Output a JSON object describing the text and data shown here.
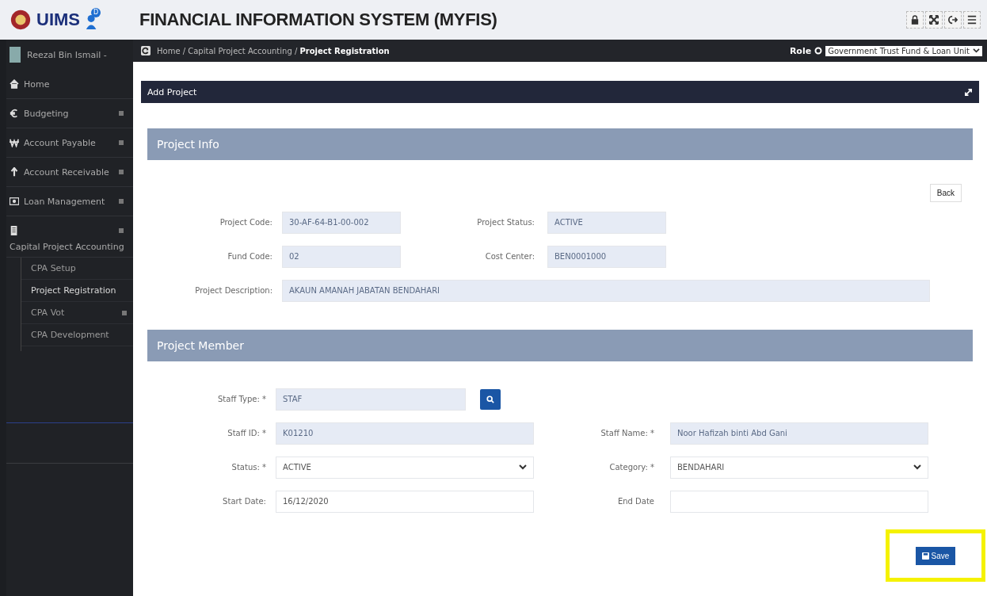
{
  "header": {
    "title": "FINANCIAL INFORMATION SYSTEM (MYFIS)",
    "logo_text": "UIMS",
    "badge": "D"
  },
  "sidebar": {
    "user": "Reezal Bin Ismail -",
    "items": [
      {
        "label": "Home",
        "kind": "home",
        "expandable": false,
        "expanded": false
      },
      {
        "label": "Budgeting",
        "kind": "euro",
        "expandable": true,
        "expanded": false
      },
      {
        "label": "Account Payable",
        "kind": "won",
        "expandable": true,
        "expanded": false
      },
      {
        "label": "Account Receivable",
        "kind": "arrow",
        "expandable": true,
        "expanded": false
      },
      {
        "label": "Loan Management",
        "kind": "money",
        "expandable": true,
        "expanded": false
      },
      {
        "label": "Capital Project Accounting",
        "kind": "building",
        "expandable": true,
        "expanded": true,
        "children": [
          {
            "label": "CPA Setup",
            "selected": false,
            "expandable": false
          },
          {
            "label": "Project Registration",
            "selected": true,
            "expandable": false
          },
          {
            "label": "CPA Vot",
            "selected": false,
            "expandable": true
          },
          {
            "label": "CPA Development",
            "selected": false,
            "expandable": false
          }
        ]
      }
    ]
  },
  "breadcrumb": "Home / Capital Project Accounting / **Project Registration**",
  "role": {
    "label": "Role",
    "value": "Government Trust Fund & Loan Unit"
  },
  "panel": {
    "title": "Add Project"
  },
  "project_info": {
    "title": "Project Info",
    "back_button": "Back",
    "rows": [
      [
        {
          "label": "Project Code:",
          "value": "30-AF-64-B1-00-002",
          "kind": "input",
          "readonly": true
        },
        {
          "label": "Project Status:",
          "value": "ACTIVE",
          "kind": "input",
          "readonly": true
        }
      ],
      [
        {
          "label": "Fund Code:",
          "value": "02",
          "kind": "input",
          "readonly": true
        },
        {
          "label": "Cost Center:",
          "value": "BEN0001000",
          "kind": "input",
          "readonly": true
        }
      ],
      [
        {
          "label": "Project Description:",
          "value": "AKAUN AMANAH JABATAN BENDAHARI",
          "kind": "input",
          "readonly": true,
          "wide": true
        }
      ]
    ]
  },
  "project_member": {
    "title": "Project Member",
    "save_button": "Save",
    "rows": [
      [
        {
          "label": "Staff Type: *",
          "value": "STAF",
          "kind": "lookup",
          "readonly": true
        }
      ],
      [
        {
          "label": "Staff ID: *",
          "value": "K01210",
          "kind": "input",
          "readonly": true
        },
        {
          "label": "Staff Name: *",
          "value": "Noor Hafizah binti Abd Gani",
          "kind": "input",
          "readonly": true
        }
      ],
      [
        {
          "label": "Status: *",
          "value": "ACTIVE",
          "kind": "select",
          "readonly": false
        },
        {
          "label": "Category: *",
          "value": "BENDAHARI",
          "kind": "select",
          "readonly": false
        }
      ],
      [
        {
          "label": "Start Date:",
          "value": "16/12/2020",
          "kind": "input",
          "readonly": false
        },
        {
          "label": "End Date",
          "kind": "input",
          "readonly": false
        }
      ]
    ]
  }
}
